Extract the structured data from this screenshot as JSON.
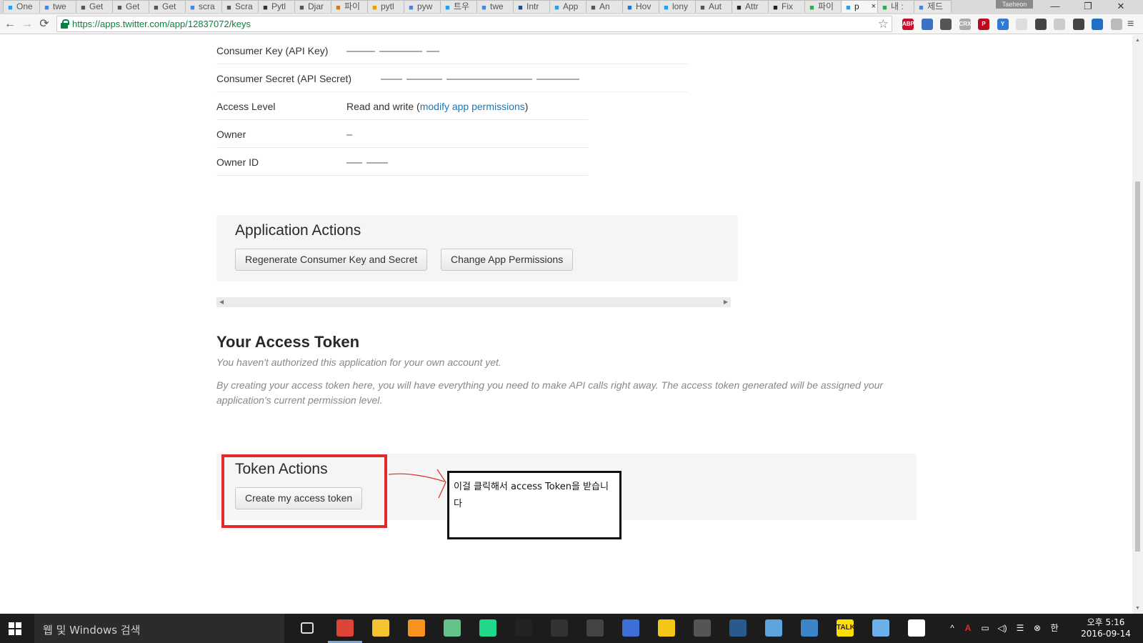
{
  "browser": {
    "tabs": [
      {
        "label": "One",
        "icon": "twitter-bird-icon",
        "color": "#1da1f2"
      },
      {
        "label": "twe",
        "icon": "google-icon",
        "color": "#4285f4"
      },
      {
        "label": "Get",
        "icon": "doc-icon",
        "color": "#555"
      },
      {
        "label": "Get",
        "icon": "doc-icon",
        "color": "#555"
      },
      {
        "label": "Get",
        "icon": "doc-icon",
        "color": "#555"
      },
      {
        "label": "scra",
        "icon": "google-icon",
        "color": "#4285f4"
      },
      {
        "label": "Scra",
        "icon": "doc-icon",
        "color": "#555"
      },
      {
        "label": "Pytl",
        "icon": "lpd-icon",
        "color": "#333"
      },
      {
        "label": "Djar",
        "icon": "book-icon",
        "color": "#555"
      },
      {
        "label": "파이",
        "icon": "orange-circle-icon",
        "color": "#e8710a"
      },
      {
        "label": "pytl",
        "icon": "pen-icon",
        "color": "#e8a000"
      },
      {
        "label": "pyw",
        "icon": "google-icon",
        "color": "#4285f4"
      },
      {
        "label": "트우",
        "icon": "twitter-bird-icon",
        "color": "#1da1f2"
      },
      {
        "label": "twe",
        "icon": "google-icon",
        "color": "#4285f4"
      },
      {
        "label": "Intr",
        "icon": "jira-icon",
        "color": "#205081"
      },
      {
        "label": "App",
        "icon": "twitter-bird-icon",
        "color": "#1da1f2"
      },
      {
        "label": "An",
        "icon": "page-icon",
        "color": "#555"
      },
      {
        "label": "Hov",
        "icon": "loop-icon",
        "color": "#1a73e8"
      },
      {
        "label": "lony",
        "icon": "twitter-bird-icon",
        "color": "#1da1f2"
      },
      {
        "label": "Aut",
        "icon": "doc-icon",
        "color": "#555"
      },
      {
        "label": "Attr",
        "icon": "github-icon",
        "color": "#222"
      },
      {
        "label": "Fix",
        "icon": "github-icon",
        "color": "#222"
      },
      {
        "label": "파이",
        "icon": "drive-icon",
        "color": "#34a853"
      },
      {
        "label": "p",
        "icon": "twitter-bird-icon",
        "color": "#1da1f2",
        "active": true
      },
      {
        "label": "내 :",
        "icon": "drive-icon",
        "color": "#34a853"
      },
      {
        "label": "제드",
        "icon": "blue-doc-icon",
        "color": "#4285f4"
      }
    ],
    "close_tab_glyph": "×",
    "profile_name": "Taeheon",
    "window_controls": [
      "—",
      "❐",
      "✕"
    ],
    "nav": {
      "back": "←",
      "forward": "→",
      "reload": "⟳"
    },
    "url": "https://apps.twitter.com/app/12837072/keys",
    "bookmark_star": "☆",
    "extensions": [
      {
        "label": "ABP",
        "icon": "adblock-icon",
        "color": "#c70d2c"
      },
      {
        "label": "",
        "icon": "shield-icon",
        "color": "#3b73c4"
      },
      {
        "label": "",
        "icon": "sync-icon",
        "color": "#555"
      },
      {
        "label": "CRX",
        "icon": "crx-icon",
        "color": "#aaa"
      },
      {
        "label": "P",
        "icon": "pinterest-icon",
        "color": "#bd081c"
      },
      {
        "label": "Y",
        "icon": "y-icon",
        "color": "#2f7bd4"
      },
      {
        "label": "",
        "icon": "circle-icon",
        "color": "#ddd"
      },
      {
        "label": "",
        "icon": "pocket-icon",
        "color": "#444"
      },
      {
        "label": "",
        "icon": "grid-icon",
        "color": "#ccc"
      },
      {
        "label": "",
        "icon": "key-icon",
        "color": "#444"
      },
      {
        "label": "",
        "icon": "edge-icon",
        "color": "#1e6fc8"
      },
      {
        "label": "",
        "icon": "cast-icon",
        "color": "#bbb"
      }
    ],
    "menu_glyph": "≡"
  },
  "keys_table": {
    "rows": [
      {
        "key": "Consumer Key (API Key)",
        "redacted": true
      },
      {
        "key": "Consumer Secret (API Secret)",
        "redacted": true
      },
      {
        "key": "Access Level",
        "value_prefix": "Read and write (",
        "link": "modify app permissions",
        "value_suffix": ")"
      },
      {
        "key": "Owner",
        "redacted": true
      },
      {
        "key": "Owner ID",
        "redacted": true
      }
    ]
  },
  "application_actions": {
    "title": "Application Actions",
    "buttons": [
      "Regenerate Consumer Key and Secret",
      "Change App Permissions"
    ]
  },
  "access_token": {
    "heading": "Your Access Token",
    "note1": "You haven't authorized this application for your own account yet.",
    "note2": "By creating your access token here, you will have everything you need to make API calls right away. The access token generated will be assigned your application's current permission level."
  },
  "token_actions": {
    "title": "Token Actions",
    "button": "Create my access token"
  },
  "annotation": {
    "text": "이걸 클릭해서 access Token을 받습니다",
    "box_color": "#e02b2b",
    "arrow_color": "#e02b2b"
  },
  "taskbar": {
    "search_placeholder": "웹 및 Windows 검색",
    "apps": [
      {
        "icon": "task-view-icon",
        "color": "#1c1c1c"
      },
      {
        "icon": "chrome-icon",
        "color": "#db4437",
        "active": true
      },
      {
        "icon": "folder-icon",
        "color": "#f4c430"
      },
      {
        "icon": "sublime-icon",
        "color": "#f7931e"
      },
      {
        "icon": "atom-icon",
        "color": "#66c28b"
      },
      {
        "icon": "pycharm-icon",
        "color": "#21d789"
      },
      {
        "icon": "unity-icon",
        "color": "#222"
      },
      {
        "icon": "epic-icon",
        "color": "#333"
      },
      {
        "icon": "terminal-icon",
        "color": "#444"
      },
      {
        "icon": "network-icon",
        "color": "#3d6fd6"
      },
      {
        "icon": "lightbulb-icon",
        "color": "#f5c518"
      },
      {
        "icon": "game-icon",
        "color": "#555"
      },
      {
        "icon": "steam-icon",
        "color": "#2a5a8c"
      },
      {
        "icon": "cloud-icon",
        "color": "#5ea3de"
      },
      {
        "icon": "monitor-icon",
        "color": "#3a86c8"
      },
      {
        "icon": "kakaotalk-icon",
        "color": "#f9e000",
        "label": "TALK"
      },
      {
        "icon": "paint-icon",
        "color": "#6bb0e8"
      },
      {
        "icon": "photos-icon",
        "color": "#fff"
      }
    ],
    "tray": {
      "chevron": "^",
      "icons": [
        "acrobat-icon",
        "battery-icon",
        "volume-icon",
        "notes-icon",
        "close-circle-icon"
      ],
      "ime": "한",
      "time": "오후 5:16",
      "date": "2016-09-14"
    }
  }
}
